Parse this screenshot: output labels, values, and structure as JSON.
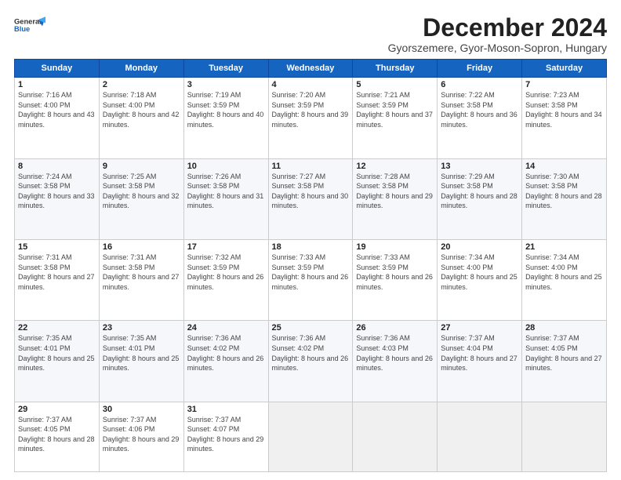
{
  "header": {
    "logo_line1": "General",
    "logo_line2": "Blue",
    "title": "December 2024",
    "subtitle": "Gyorszemere, Gyor-Moson-Sopron, Hungary"
  },
  "days_of_week": [
    "Sunday",
    "Monday",
    "Tuesday",
    "Wednesday",
    "Thursday",
    "Friday",
    "Saturday"
  ],
  "weeks": [
    [
      {
        "day": 1,
        "rise": "7:16 AM",
        "set": "4:00 PM",
        "daylight": "8 hours and 43 minutes."
      },
      {
        "day": 2,
        "rise": "7:18 AM",
        "set": "4:00 PM",
        "daylight": "8 hours and 42 minutes."
      },
      {
        "day": 3,
        "rise": "7:19 AM",
        "set": "3:59 PM",
        "daylight": "8 hours and 40 minutes."
      },
      {
        "day": 4,
        "rise": "7:20 AM",
        "set": "3:59 PM",
        "daylight": "8 hours and 39 minutes."
      },
      {
        "day": 5,
        "rise": "7:21 AM",
        "set": "3:59 PM",
        "daylight": "8 hours and 37 minutes."
      },
      {
        "day": 6,
        "rise": "7:22 AM",
        "set": "3:58 PM",
        "daylight": "8 hours and 36 minutes."
      },
      {
        "day": 7,
        "rise": "7:23 AM",
        "set": "3:58 PM",
        "daylight": "8 hours and 34 minutes."
      }
    ],
    [
      {
        "day": 8,
        "rise": "7:24 AM",
        "set": "3:58 PM",
        "daylight": "8 hours and 33 minutes."
      },
      {
        "day": 9,
        "rise": "7:25 AM",
        "set": "3:58 PM",
        "daylight": "8 hours and 32 minutes."
      },
      {
        "day": 10,
        "rise": "7:26 AM",
        "set": "3:58 PM",
        "daylight": "8 hours and 31 minutes."
      },
      {
        "day": 11,
        "rise": "7:27 AM",
        "set": "3:58 PM",
        "daylight": "8 hours and 30 minutes."
      },
      {
        "day": 12,
        "rise": "7:28 AM",
        "set": "3:58 PM",
        "daylight": "8 hours and 29 minutes."
      },
      {
        "day": 13,
        "rise": "7:29 AM",
        "set": "3:58 PM",
        "daylight": "8 hours and 28 minutes."
      },
      {
        "day": 14,
        "rise": "7:30 AM",
        "set": "3:58 PM",
        "daylight": "8 hours and 28 minutes."
      }
    ],
    [
      {
        "day": 15,
        "rise": "7:31 AM",
        "set": "3:58 PM",
        "daylight": "8 hours and 27 minutes."
      },
      {
        "day": 16,
        "rise": "7:31 AM",
        "set": "3:58 PM",
        "daylight": "8 hours and 27 minutes."
      },
      {
        "day": 17,
        "rise": "7:32 AM",
        "set": "3:59 PM",
        "daylight": "8 hours and 26 minutes."
      },
      {
        "day": 18,
        "rise": "7:33 AM",
        "set": "3:59 PM",
        "daylight": "8 hours and 26 minutes."
      },
      {
        "day": 19,
        "rise": "7:33 AM",
        "set": "3:59 PM",
        "daylight": "8 hours and 26 minutes."
      },
      {
        "day": 20,
        "rise": "7:34 AM",
        "set": "4:00 PM",
        "daylight": "8 hours and 25 minutes."
      },
      {
        "day": 21,
        "rise": "7:34 AM",
        "set": "4:00 PM",
        "daylight": "8 hours and 25 minutes."
      }
    ],
    [
      {
        "day": 22,
        "rise": "7:35 AM",
        "set": "4:01 PM",
        "daylight": "8 hours and 25 minutes."
      },
      {
        "day": 23,
        "rise": "7:35 AM",
        "set": "4:01 PM",
        "daylight": "8 hours and 25 minutes."
      },
      {
        "day": 24,
        "rise": "7:36 AM",
        "set": "4:02 PM",
        "daylight": "8 hours and 26 minutes."
      },
      {
        "day": 25,
        "rise": "7:36 AM",
        "set": "4:02 PM",
        "daylight": "8 hours and 26 minutes."
      },
      {
        "day": 26,
        "rise": "7:36 AM",
        "set": "4:03 PM",
        "daylight": "8 hours and 26 minutes."
      },
      {
        "day": 27,
        "rise": "7:37 AM",
        "set": "4:04 PM",
        "daylight": "8 hours and 27 minutes."
      },
      {
        "day": 28,
        "rise": "7:37 AM",
        "set": "4:05 PM",
        "daylight": "8 hours and 27 minutes."
      }
    ],
    [
      {
        "day": 29,
        "rise": "7:37 AM",
        "set": "4:05 PM",
        "daylight": "8 hours and 28 minutes."
      },
      {
        "day": 30,
        "rise": "7:37 AM",
        "set": "4:06 PM",
        "daylight": "8 hours and 29 minutes."
      },
      {
        "day": 31,
        "rise": "7:37 AM",
        "set": "4:07 PM",
        "daylight": "8 hours and 29 minutes."
      },
      null,
      null,
      null,
      null
    ]
  ]
}
